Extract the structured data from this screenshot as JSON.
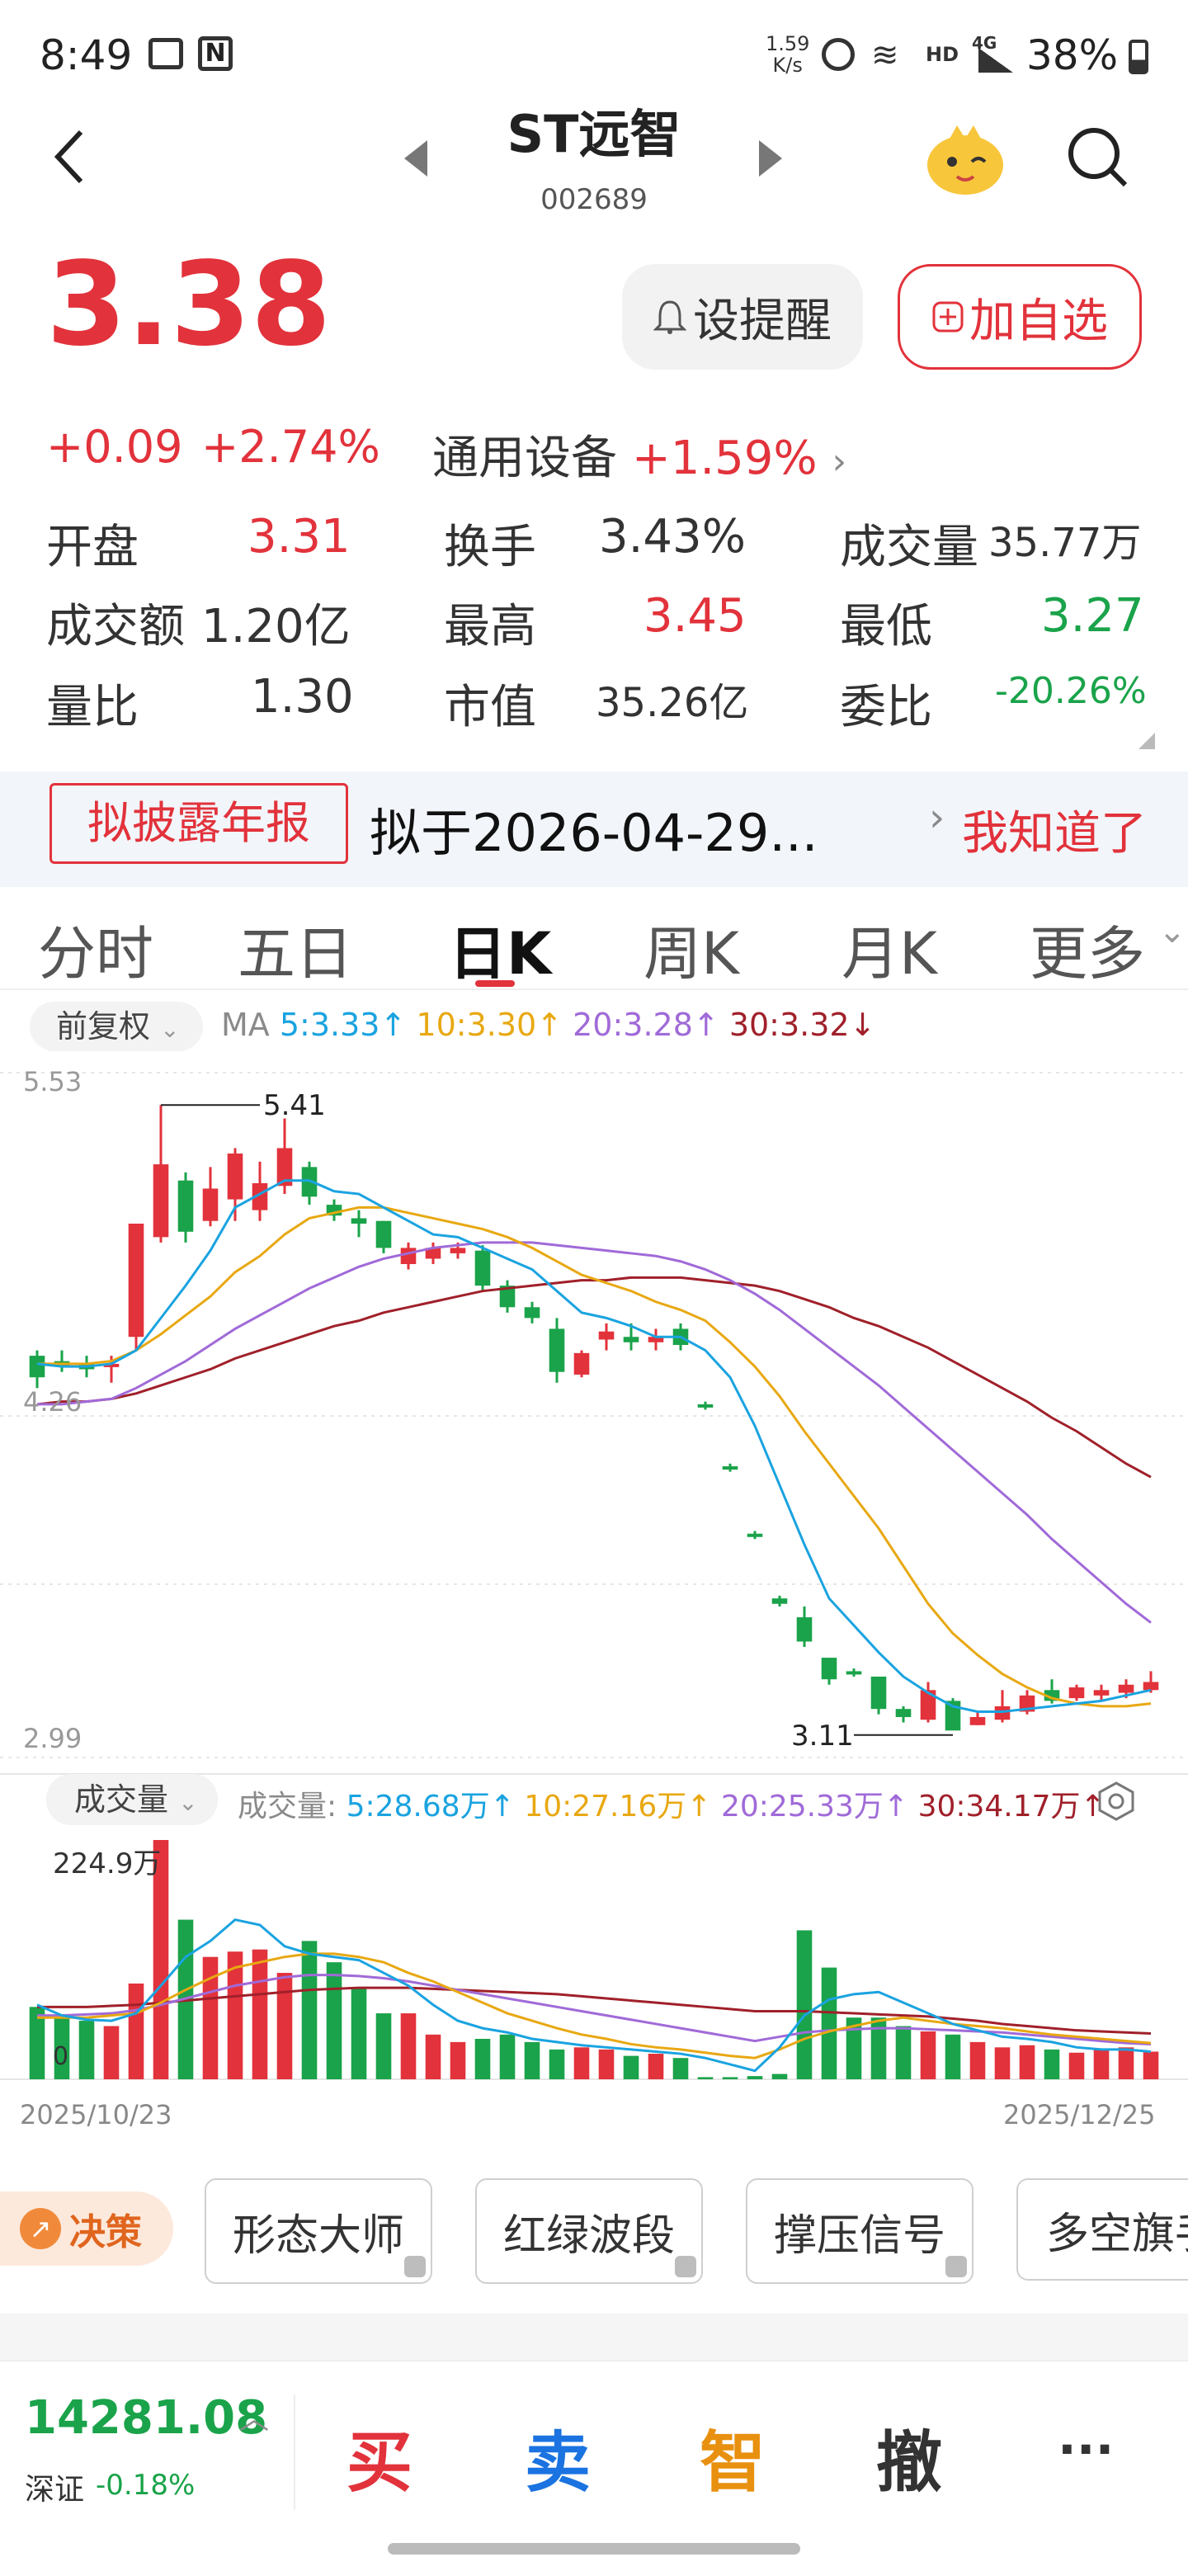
{
  "status": {
    "time": "8:49",
    "net_speed_top": "1.59",
    "net_speed_bottom": "K/s",
    "signal_label": "HD",
    "network": "4G",
    "battery": "38%"
  },
  "header": {
    "title": "ST远智",
    "code": "002689"
  },
  "quote": {
    "price": "3.38",
    "change": "+0.09",
    "change_pct": "+2.74%",
    "sector_name": "通用设备",
    "sector_pct": "+1.59%",
    "alert_label": "设提醒",
    "add_label": "加自选"
  },
  "stats": {
    "open_label": "开盘",
    "open_value": "3.31",
    "turnover_label": "换手",
    "turnover_value": "3.43%",
    "volume_label": "成交量",
    "volume_value": "35.77万",
    "amount_label": "成交额",
    "amount_value": "1.20亿",
    "high_label": "最高",
    "high_value": "3.45",
    "low_label": "最低",
    "low_value": "3.27",
    "ratio_label": "量比",
    "ratio_value": "1.30",
    "cap_label": "市值",
    "cap_value": "35.26亿",
    "order_label": "委比",
    "order_value": "-20.26%"
  },
  "banner": {
    "tag": "拟披露年报",
    "text": "拟于2026-04-29...",
    "dismiss": "我知道了"
  },
  "tabs": [
    "分时",
    "五日",
    "日K",
    "周K",
    "月K",
    "更多"
  ],
  "ma_bar": {
    "adjust": "前复权",
    "ma_label": "MA",
    "ma5": "5:3.33↑",
    "ma10": "10:3.30↑",
    "ma20": "20:3.28↑",
    "ma30": "30:3.32↓"
  },
  "vol_bar": {
    "select": "成交量",
    "label": "成交量:",
    "v5": "5:28.68万↑",
    "v10": "10:27.16万↑",
    "v20": "20:25.33万↑",
    "v30": "30:34.17万↑"
  },
  "colors": {
    "up": "#e2323b",
    "down": "#1aa34a",
    "ma5": "#1aa3e0",
    "ma10": "#e8a812",
    "ma20": "#a06ad8",
    "ma30": "#a0202a"
  },
  "chart_data": {
    "type": "candlestick",
    "y_top_label": "5.53",
    "y_mid_label": "4.26",
    "y_bottom_label": "2.99",
    "high_annotation": "5.41",
    "low_annotation": "3.11",
    "vol_max_label": "224.9万",
    "vol_zero_label": "0",
    "x_start": "2025/10/23",
    "x_end": "2025/12/25",
    "ylim": [
      2.99,
      5.53
    ],
    "candles": [
      {
        "o": 4.48,
        "c": 4.4,
        "h": 4.5,
        "l": 4.36
      },
      {
        "o": 4.46,
        "c": 4.44,
        "h": 4.5,
        "l": 4.42
      },
      {
        "o": 4.45,
        "c": 4.43,
        "h": 4.48,
        "l": 4.4
      },
      {
        "o": 4.44,
        "c": 4.45,
        "h": 4.48,
        "l": 4.38
      },
      {
        "o": 4.55,
        "c": 4.97,
        "h": 4.97,
        "l": 4.5
      },
      {
        "o": 4.92,
        "c": 5.19,
        "h": 5.41,
        "l": 4.9
      },
      {
        "o": 5.13,
        "c": 4.94,
        "h": 5.16,
        "l": 4.9
      },
      {
        "o": 4.98,
        "c": 5.1,
        "h": 5.18,
        "l": 4.96
      },
      {
        "o": 5.06,
        "c": 5.23,
        "h": 5.25,
        "l": 4.98
      },
      {
        "o": 5.02,
        "c": 5.12,
        "h": 5.2,
        "l": 4.98
      },
      {
        "o": 5.11,
        "c": 5.25,
        "h": 5.36,
        "l": 5.08
      },
      {
        "o": 5.18,
        "c": 5.07,
        "h": 5.2,
        "l": 5.04
      },
      {
        "o": 5.04,
        "c": 5.0,
        "h": 5.06,
        "l": 4.98
      },
      {
        "o": 4.99,
        "c": 4.97,
        "h": 5.02,
        "l": 4.92
      },
      {
        "o": 4.98,
        "c": 4.88,
        "h": 4.98,
        "l": 4.86
      },
      {
        "o": 4.82,
        "c": 4.88,
        "h": 4.9,
        "l": 4.8
      },
      {
        "o": 4.84,
        "c": 4.88,
        "h": 4.9,
        "l": 4.82
      },
      {
        "o": 4.86,
        "c": 4.88,
        "h": 4.9,
        "l": 4.84
      },
      {
        "o": 4.87,
        "c": 4.74,
        "h": 4.89,
        "l": 4.72
      },
      {
        "o": 4.74,
        "c": 4.66,
        "h": 4.76,
        "l": 4.64
      },
      {
        "o": 4.66,
        "c": 4.62,
        "h": 4.68,
        "l": 4.6
      },
      {
        "o": 4.58,
        "c": 4.42,
        "h": 4.62,
        "l": 4.38
      },
      {
        "o": 4.41,
        "c": 4.49,
        "h": 4.5,
        "l": 4.4
      },
      {
        "o": 4.54,
        "c": 4.57,
        "h": 4.6,
        "l": 4.5
      },
      {
        "o": 4.55,
        "c": 4.53,
        "h": 4.6,
        "l": 4.5
      },
      {
        "o": 4.53,
        "c": 4.55,
        "h": 4.58,
        "l": 4.5
      },
      {
        "o": 4.58,
        "c": 4.52,
        "h": 4.6,
        "l": 4.5
      },
      {
        "o": 4.3,
        "c": 4.29,
        "h": 4.31,
        "l": 4.28
      },
      {
        "o": 4.07,
        "c": 4.06,
        "h": 4.08,
        "l": 4.05
      },
      {
        "o": 3.82,
        "c": 3.81,
        "h": 3.83,
        "l": 3.8
      },
      {
        "o": 3.58,
        "c": 3.56,
        "h": 3.59,
        "l": 3.55
      },
      {
        "o": 3.51,
        "c": 3.42,
        "h": 3.55,
        "l": 3.4
      },
      {
        "o": 3.36,
        "c": 3.28,
        "h": 3.36,
        "l": 3.26
      },
      {
        "o": 3.31,
        "c": 3.3,
        "h": 3.32,
        "l": 3.29
      },
      {
        "o": 3.29,
        "c": 3.17,
        "h": 3.29,
        "l": 3.15
      },
      {
        "o": 3.17,
        "c": 3.14,
        "h": 3.18,
        "l": 3.12
      },
      {
        "o": 3.13,
        "c": 3.24,
        "h": 3.27,
        "l": 3.12
      },
      {
        "o": 3.2,
        "c": 3.09,
        "h": 3.21,
        "l": 3.11
      },
      {
        "o": 3.11,
        "c": 3.14,
        "h": 3.16,
        "l": 3.11
      },
      {
        "o": 3.13,
        "c": 3.18,
        "h": 3.24,
        "l": 3.12
      },
      {
        "o": 3.16,
        "c": 3.22,
        "h": 3.24,
        "l": 3.15
      },
      {
        "o": 3.24,
        "c": 3.2,
        "h": 3.28,
        "l": 3.19
      },
      {
        "o": 3.21,
        "c": 3.25,
        "h": 3.26,
        "l": 3.2
      },
      {
        "o": 3.22,
        "c": 3.24,
        "h": 3.26,
        "l": 3.2
      },
      {
        "o": 3.23,
        "c": 3.26,
        "h": 3.28,
        "l": 3.21
      },
      {
        "o": 3.24,
        "c": 3.27,
        "h": 3.31,
        "l": 3.23
      }
    ],
    "ma5": [
      4.45,
      4.44,
      4.44,
      4.45,
      4.5,
      4.62,
      4.74,
      4.87,
      5.03,
      5.08,
      5.13,
      5.13,
      5.09,
      5.08,
      5.03,
      4.98,
      4.93,
      4.92,
      4.88,
      4.84,
      4.8,
      4.72,
      4.64,
      4.62,
      4.59,
      4.55,
      4.55,
      4.5,
      4.4,
      4.22,
      4.0,
      3.78,
      3.58,
      3.48,
      3.38,
      3.29,
      3.23,
      3.18,
      3.16,
      3.16,
      3.17,
      3.18,
      3.19,
      3.2,
      3.22,
      3.24
    ],
    "ma10": [
      4.45,
      4.45,
      4.45,
      4.46,
      4.5,
      4.56,
      4.63,
      4.7,
      4.79,
      4.85,
      4.93,
      4.99,
      5.01,
      5.03,
      5.03,
      5.01,
      4.99,
      4.97,
      4.95,
      4.92,
      4.88,
      4.83,
      4.78,
      4.75,
      4.72,
      4.68,
      4.65,
      4.61,
      4.53,
      4.44,
      4.33,
      4.2,
      4.08,
      3.96,
      3.84,
      3.7,
      3.56,
      3.45,
      3.37,
      3.3,
      3.25,
      3.21,
      3.19,
      3.18,
      3.18,
      3.19
    ],
    "ma20": [
      4.3,
      4.3,
      4.31,
      4.32,
      4.36,
      4.41,
      4.46,
      4.52,
      4.58,
      4.63,
      4.68,
      4.73,
      4.77,
      4.81,
      4.84,
      4.86,
      4.88,
      4.89,
      4.9,
      4.9,
      4.9,
      4.89,
      4.88,
      4.87,
      4.86,
      4.85,
      4.83,
      4.8,
      4.76,
      4.71,
      4.65,
      4.58,
      4.51,
      4.44,
      4.37,
      4.29,
      4.21,
      4.13,
      4.05,
      3.97,
      3.89,
      3.8,
      3.72,
      3.64,
      3.56,
      3.49
    ],
    "ma30": [
      4.3,
      4.31,
      4.31,
      4.32,
      4.34,
      4.37,
      4.4,
      4.43,
      4.47,
      4.5,
      4.53,
      4.56,
      4.59,
      4.61,
      4.64,
      4.66,
      4.68,
      4.7,
      4.72,
      4.73,
      4.74,
      4.75,
      4.76,
      4.76,
      4.77,
      4.77,
      4.77,
      4.76,
      4.75,
      4.74,
      4.72,
      4.69,
      4.66,
      4.62,
      4.59,
      4.55,
      4.51,
      4.46,
      4.41,
      4.36,
      4.31,
      4.25,
      4.2,
      4.14,
      4.08,
      4.03
    ],
    "volume_max": 224.9,
    "volumes": [
      68,
      60,
      55,
      50,
      90,
      224.9,
      150,
      115,
      120,
      122,
      100,
      130,
      110,
      85,
      62,
      62,
      42,
      35,
      38,
      42,
      35,
      28,
      30,
      28,
      22,
      24,
      20,
      2,
      2,
      3,
      5,
      140,
      105,
      58,
      58,
      50,
      45,
      42,
      35,
      30,
      32,
      28,
      25,
      28,
      30,
      26
    ],
    "vol_ma5": [
      70,
      60,
      56,
      55,
      62,
      88,
      115,
      130,
      150,
      145,
      125,
      118,
      115,
      112,
      100,
      88,
      70,
      55,
      48,
      44,
      38,
      35,
      32,
      30,
      28,
      26,
      24,
      20,
      14,
      8,
      30,
      60,
      75,
      80,
      82,
      72,
      62,
      52,
      46,
      40,
      38,
      35,
      30,
      28,
      28,
      26
    ],
    "vol_ma10": [
      58,
      58,
      58,
      60,
      62,
      72,
      84,
      95,
      105,
      110,
      115,
      118,
      118,
      115,
      110,
      100,
      92,
      82,
      72,
      62,
      55,
      48,
      42,
      38,
      33,
      30,
      28,
      25,
      22,
      20,
      28,
      38,
      45,
      50,
      55,
      58,
      55,
      52,
      50,
      48,
      45,
      42,
      40,
      38,
      36,
      34
    ],
    "vol_ma20": [
      60,
      60,
      61,
      62,
      65,
      70,
      76,
      82,
      88,
      92,
      96,
      98,
      98,
      97,
      95,
      92,
      88,
      84,
      80,
      76,
      72,
      68,
      64,
      60,
      56,
      52,
      48,
      44,
      40,
      36,
      40,
      44,
      46,
      47,
      48,
      48,
      47,
      46,
      45,
      44,
      42,
      40,
      38,
      36,
      34,
      33
    ],
    "vol_ma30": [
      68,
      68,
      68,
      69,
      70,
      72,
      74,
      76,
      78,
      80,
      82,
      84,
      85,
      86,
      86,
      86,
      85,
      84,
      83,
      82,
      81,
      80,
      78,
      76,
      74,
      72,
      70,
      68,
      66,
      64,
      64,
      64,
      63,
      62,
      61,
      60,
      59,
      57,
      55,
      52,
      50,
      48,
      46,
      45,
      44,
      43
    ]
  },
  "tools": {
    "decision_label": "决策",
    "items": [
      "形态大师",
      "红绿波段",
      "撑压信号",
      "多空旗手"
    ]
  },
  "footer": {
    "index_value": "14281.08",
    "index_name": "深证",
    "index_change": "-0.18%",
    "buy": "买",
    "sell": "卖",
    "smart": "智",
    "cancel": "撤",
    "more": "···"
  }
}
